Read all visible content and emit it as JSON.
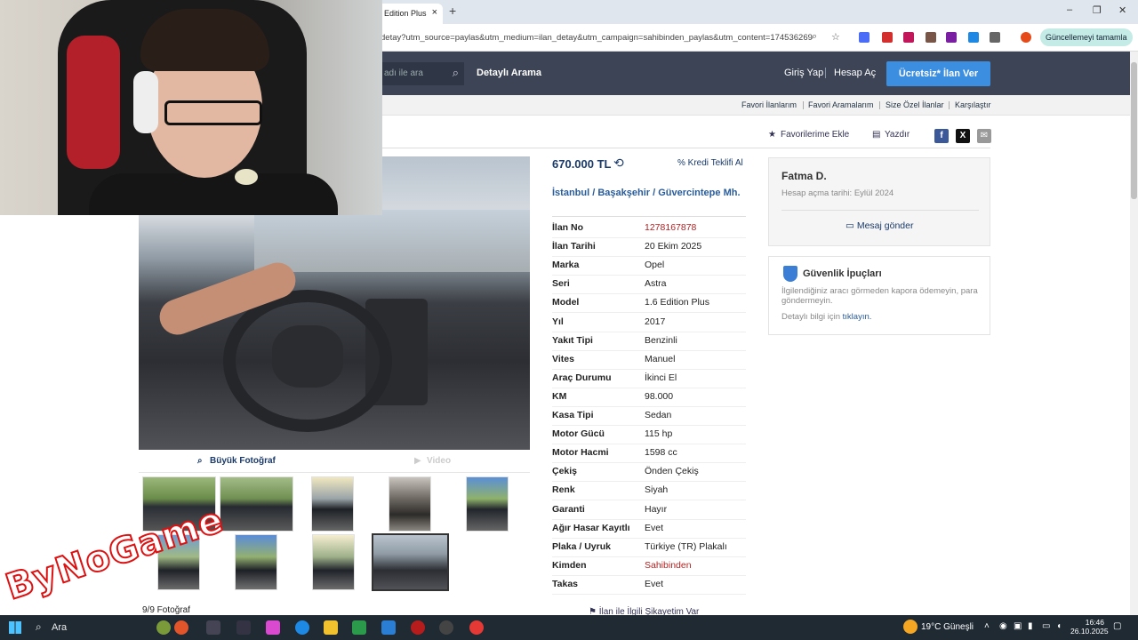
{
  "browser": {
    "tab_title": "Edition Plus",
    "new_tab": "+",
    "url": "detay?utm_source=paylas&utm_medium=ilan_detay&utm_campaign=sahibinden_paylas&utm_content=174536269",
    "update_button": "Güncellemeyi tamamla",
    "minimize": "–",
    "restore": "❐",
    "close": "✕"
  },
  "header": {
    "search_placeholder": "adı ile ara",
    "advanced_search": "Detaylı Arama",
    "login": "Giriş Yap",
    "register": "Hesap Aç",
    "post_ad": "Ücretsiz* İlan Ver"
  },
  "subnav": {
    "items": [
      "Favori İlanlarım",
      "Favori Aramalarım",
      "Size Özel İlanlar",
      "Karşılaştır"
    ]
  },
  "actions": {
    "favorite": "Favorilerime Ekle",
    "print": "Yazdır"
  },
  "photo_tabs": {
    "big_photo": "Büyük Fotoğraf",
    "video": "Video"
  },
  "photo_count": "9/9 Fotoğraf",
  "listing": {
    "price": "670.000 TL",
    "loan_offer": "Kredi Teklifi Al",
    "location": "İstanbul  /  Başakşehir  /  Güvercintepe Mh.",
    "details": [
      {
        "k": "İlan No",
        "v": "1278167878",
        "red": true
      },
      {
        "k": "İlan Tarihi",
        "v": "20 Ekim 2025"
      },
      {
        "k": "Marka",
        "v": "Opel"
      },
      {
        "k": "Seri",
        "v": "Astra"
      },
      {
        "k": "Model",
        "v": "1.6 Edition Plus"
      },
      {
        "k": "Yıl",
        "v": "2017"
      },
      {
        "k": "Yakıt Tipi",
        "v": "Benzinli"
      },
      {
        "k": "Vites",
        "v": "Manuel"
      },
      {
        "k": "Araç Durumu",
        "v": "İkinci El"
      },
      {
        "k": "KM",
        "v": "98.000"
      },
      {
        "k": "Kasa Tipi",
        "v": "Sedan"
      },
      {
        "k": "Motor Gücü",
        "v": "115 hp"
      },
      {
        "k": "Motor Hacmi",
        "v": "1598 cc"
      },
      {
        "k": "Çekiş",
        "v": "Önden Çekiş"
      },
      {
        "k": "Renk",
        "v": "Siyah"
      },
      {
        "k": "Garanti",
        "v": "Hayır"
      },
      {
        "k": "Ağır Hasar Kayıtlı",
        "v": "Evet"
      },
      {
        "k": "Plaka / Uyruk",
        "v": "Türkiye (TR) Plakalı"
      },
      {
        "k": "Kimden",
        "v": "Sahibinden",
        "red": true
      },
      {
        "k": "Takas",
        "v": "Evet"
      }
    ],
    "complaint": "İlan ile İlgili Şikayetim Var"
  },
  "seller": {
    "name": "Fatma D.",
    "since": "Hesap açma tarihi: Eylül 2024",
    "message": "Mesaj gönder"
  },
  "safety": {
    "title": "Güvenlik İpuçları",
    "text": "İlgilendiğiniz aracı görmeden kapora ödemeyin, para göndermeyin.",
    "detail_prefix": "Detaylı bilgi için",
    "detail_link": "tıklayın."
  },
  "watermark": "ByNoGame",
  "taskbar": {
    "search": "Ara",
    "weather": "19°C  Güneşli",
    "time": "16:46",
    "date": "26.10.2025"
  },
  "colors": {
    "header_bg": "#3c4455",
    "accent_blue": "#3c8fe0",
    "link_red": "#b22222",
    "link_blue": "#2a5c9a"
  }
}
